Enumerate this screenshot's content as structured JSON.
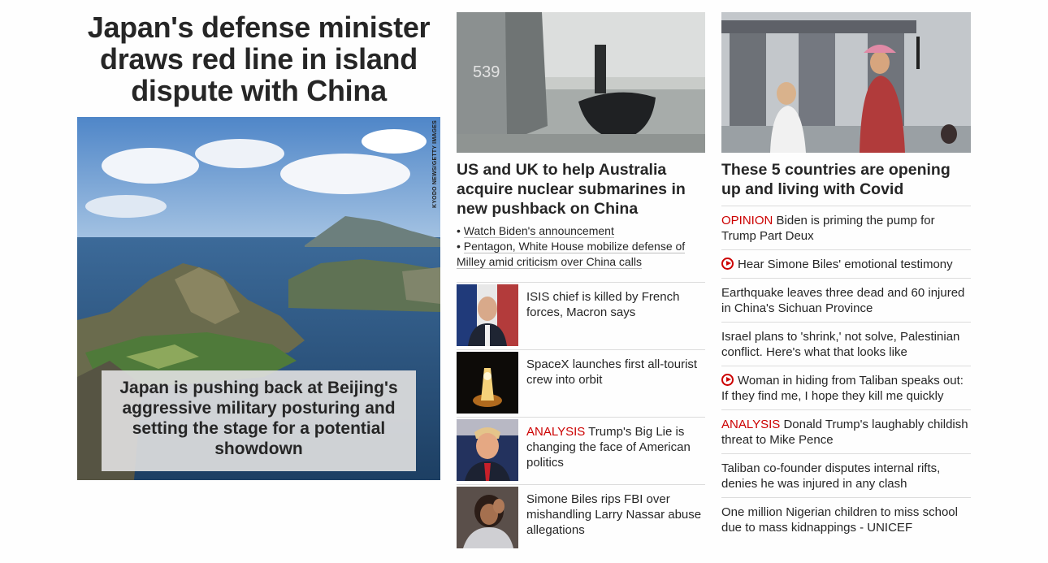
{
  "hero": {
    "title": "Japan's defense minister draws red line in island dispute with China",
    "credit": "KYODO NEWS/GETTY IMAGES",
    "caption": "Japan is pushing back at Beijing's aggressive military posturing and setting the stage for a potential showdown"
  },
  "middle": {
    "lead_title": "US and UK to help Australia acquire nuclear submarines in new pushback on China",
    "related": [
      "Watch Biden's announcement",
      "Pentagon, White House mobilize defense of Milley amid criticism over China calls"
    ],
    "stories": [
      {
        "kicker": "",
        "text": "ISIS chief is killed by French forces, Macron says",
        "thumb_icon": "portrait-photo"
      },
      {
        "kicker": "",
        "text": "SpaceX launches first all-tourist crew into orbit",
        "thumb_icon": "rocket-launch-photo"
      },
      {
        "kicker": "ANALYSIS",
        "text": "Trump's Big Lie is changing the face of American politics",
        "thumb_icon": "portrait-photo"
      },
      {
        "kicker": "",
        "text": "Simone Biles rips FBI over mishandling Larry Nassar abuse allegations",
        "thumb_icon": "portrait-photo"
      }
    ]
  },
  "right": {
    "title": "These 5 countries are opening up and living with Covid",
    "items": [
      {
        "kicker": "OPINION",
        "video": false,
        "text": "Biden is priming the pump for Trump Part Deux"
      },
      {
        "kicker": "",
        "video": true,
        "text": "Hear Simone Biles' emotional testimony"
      },
      {
        "kicker": "",
        "video": false,
        "text": "Earthquake leaves three dead and 60 injured in China's Sichuan Province"
      },
      {
        "kicker": "",
        "video": false,
        "text": "Israel plans to 'shrink,' not solve, Palestinian conflict. Here's what that looks like"
      },
      {
        "kicker": "",
        "video": true,
        "text": "Woman in hiding from Taliban speaks out: If they find me, I hope they kill me quickly"
      },
      {
        "kicker": "ANALYSIS",
        "video": false,
        "text": "Donald Trump's laughably childish threat to Mike Pence"
      },
      {
        "kicker": "",
        "video": false,
        "text": "Taliban co-founder disputes internal rifts, denies he was injured in any clash"
      },
      {
        "kicker": "",
        "video": false,
        "text": "One million Nigerian children to miss school due to mass kidnappings - UNICEF"
      }
    ]
  },
  "colors": {
    "kicker": "#cc0000",
    "text": "#262626",
    "divider": "#dcdcdc"
  }
}
